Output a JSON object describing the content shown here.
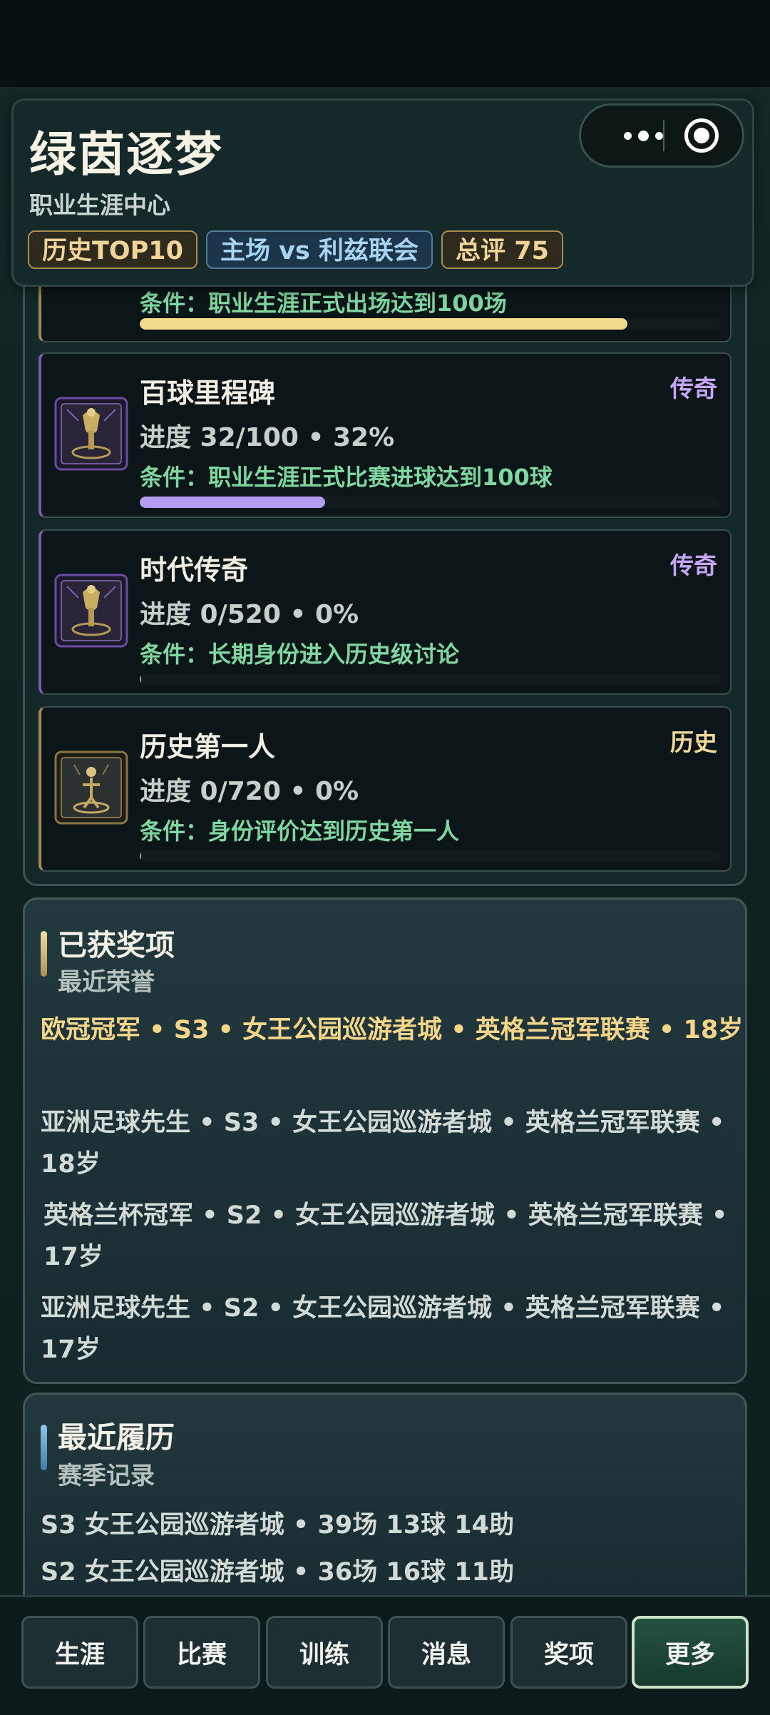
{
  "header": {
    "title": "绿茵逐梦",
    "subtitle": "职业生涯中心",
    "chips": [
      "历史TOP10",
      "主场 vs 利兹联会",
      "总评 75"
    ]
  },
  "achievements": {
    "partial": {
      "condition": "条件：职业生涯正式出场达到100场",
      "progress_ratio": 0.84
    },
    "cards": [
      {
        "name": "百球里程碑",
        "rank": "传奇",
        "progress": "进度 32/100 • 32%",
        "condition": "条件：职业生涯正式比赛进球达到100球",
        "ratio": 0.32
      },
      {
        "name": "时代传奇",
        "rank": "传奇",
        "progress": "进度 0/520 • 0%",
        "condition": "条件：长期身份进入历史级讨论",
        "ratio": 0
      },
      {
        "name": "历史第一人",
        "rank": "历史",
        "progress": "进度 0/720 • 0%",
        "condition": "条件：身份评价达到历史第一人",
        "ratio": 0
      }
    ]
  },
  "awards": {
    "title": "已获奖项",
    "subtitle": "最近荣誉",
    "items": [
      "欧冠冠军 • S3 • 女王公园巡游者城 • 英格兰冠军联赛 • 18岁",
      "亚洲足球先生 • S3 • 女王公园巡游者城 • 英格兰冠军联赛 • 18岁",
      "英格兰杯冠军 • S2 • 女王公园巡游者城 • 英格兰冠军联赛 • 17岁",
      "亚洲足球先生 • S2 • 女王公园巡游者城 • 英格兰冠军联赛 • 17岁"
    ]
  },
  "history": {
    "title": "最近履历",
    "subtitle": "赛季记录",
    "items": [
      "S3 女王公园巡游者城 • 39场 13球 14助",
      "S2 女王公园巡游者城 • 36场 16球 11助"
    ]
  },
  "nav": {
    "items": [
      "生涯",
      "比赛",
      "训练",
      "消息",
      "奖项",
      "更多"
    ],
    "active": "更多"
  },
  "colors": {
    "legend_rank": "#c7a6f5",
    "history_rank": "#f2d89a",
    "gold_bar": "#f4da8c",
    "purple_bar": "#b59cf0",
    "condition_green": "#7fd6a0"
  },
  "icons": {
    "legend_badge": "legend-trophy-icon",
    "history_badge": "history-trophy-icon"
  }
}
